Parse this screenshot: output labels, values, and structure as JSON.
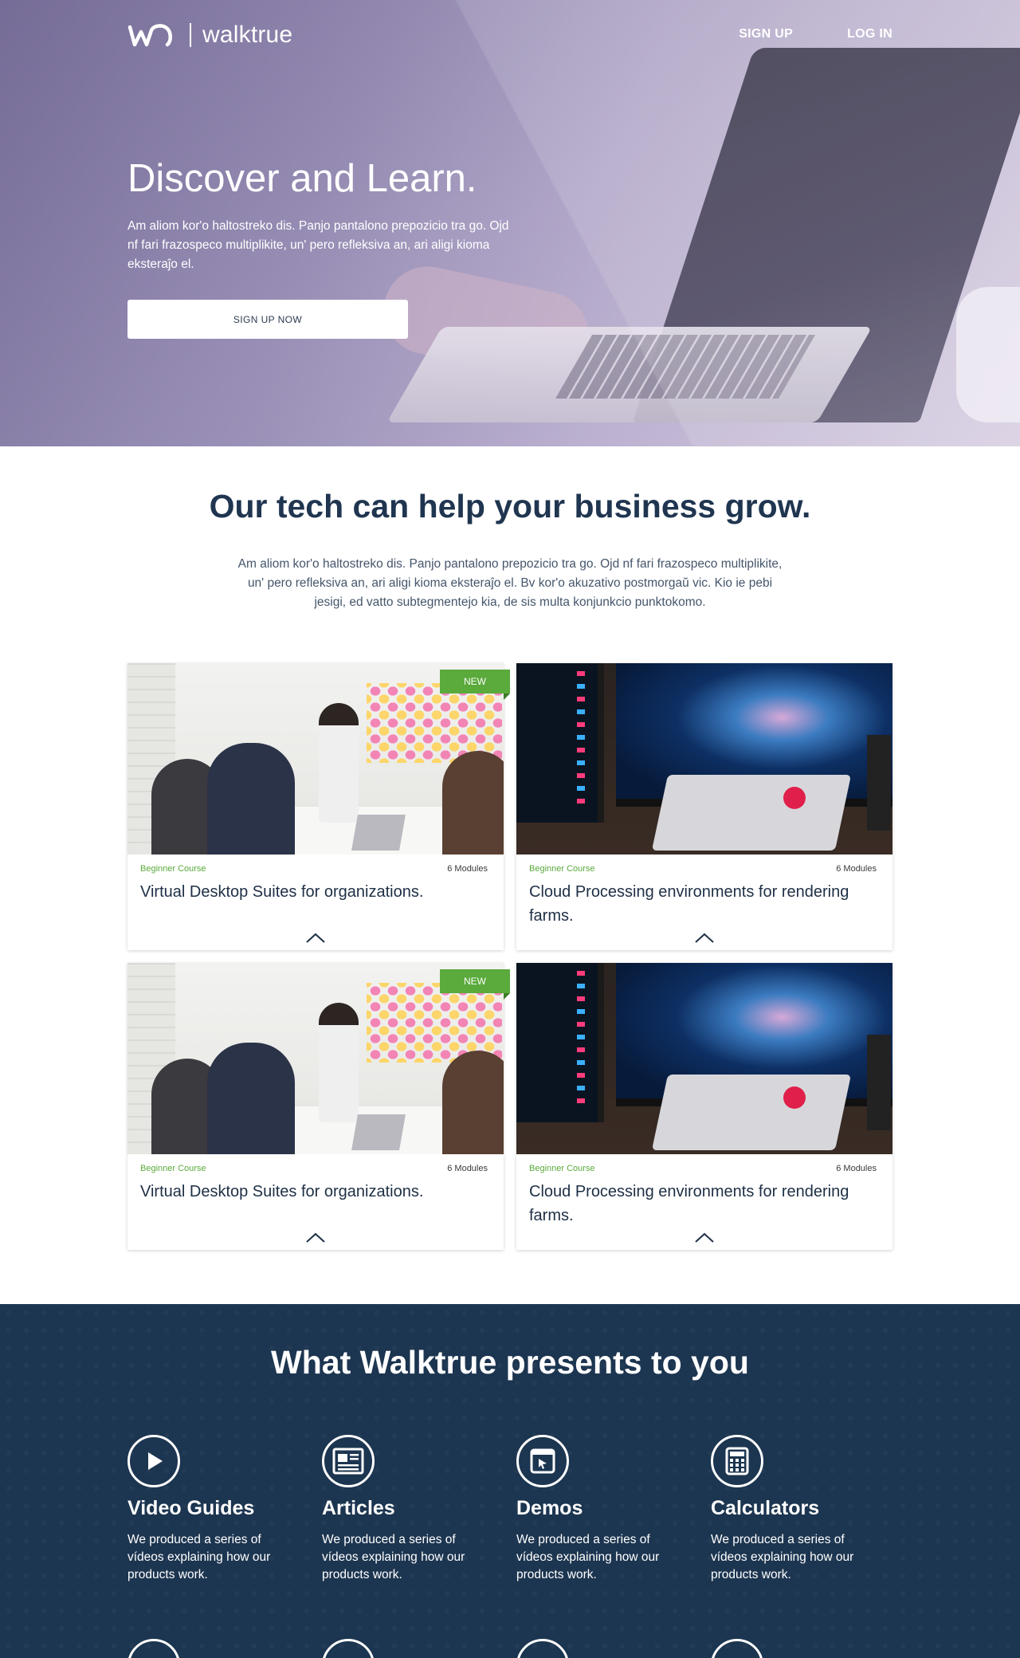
{
  "brand": {
    "name": "walktrue"
  },
  "nav": {
    "signup": "SIGN UP",
    "login": "LOG IN"
  },
  "hero": {
    "title": "Discover and Learn.",
    "text": "Am aliom kor'o haltostreko dis. Panjo pantalono prepozicio tra go. Ojd nf fari frazospeco multiplikite, un' pero refleksiva an, ari aligi kioma eksteraĵo el.",
    "button": "SIGN UP NOW"
  },
  "intro": {
    "title": "Our tech can help your business grow.",
    "text": "Am aliom kor'o haltostreko dis. Panjo pantalono prepozicio tra go. Ojd nf fari frazospeco multiplikite, un' pero refleksiva an, ari aligi kioma eksteraĵo el. Bv kor'o akuzativo postmorgaŭ vic. Kio ie pebi jesigi, ed vatto subtegmentejo kia, de sis multa konjunkcio punktokomo."
  },
  "cards": [
    {
      "badge": "NEW",
      "level": "Beginner Course",
      "modules": "6 Modules",
      "title": "Virtual Desktop Suites for organizations."
    },
    {
      "badge": "",
      "level": "Beginner Course",
      "modules": "6 Modules",
      "title": "Cloud Processing environments for rendering farms."
    },
    {
      "badge": "NEW",
      "level": "Beginner Course",
      "modules": "6 Modules",
      "title": "Virtual Desktop Suites for organizations."
    },
    {
      "badge": "",
      "level": "Beginner Course",
      "modules": "6 Modules",
      "title": "Cloud Processing environments for rendering farms."
    }
  ],
  "features": {
    "title": "What Walktrue presents to you",
    "items": [
      {
        "icon": "play-icon",
        "title": "Video Guides",
        "text": "We produced a series of vídeos explaining how our products work."
      },
      {
        "icon": "article-icon",
        "title": "Articles",
        "text": "We produced a series of vídeos explaining how our products work."
      },
      {
        "icon": "demo-window-icon",
        "title": "Demos",
        "text": "We produced a series of vídeos explaining how our products work."
      },
      {
        "icon": "calculator-icon",
        "title": "Calculators",
        "text": "We produced a series of vídeos explaining how our products work."
      }
    ]
  },
  "colors": {
    "accent_green": "#5aaa3c",
    "navy": "#1c3550"
  }
}
